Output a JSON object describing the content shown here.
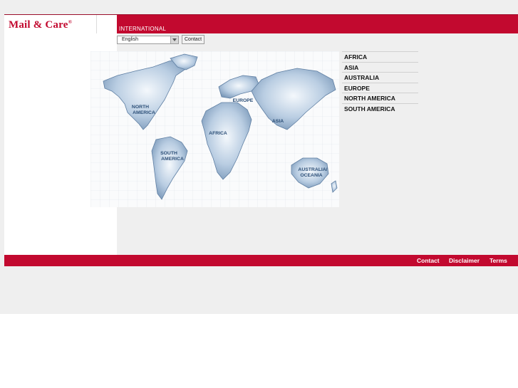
{
  "header": {
    "logo_text": "Mail & Care",
    "logo_mark": "®",
    "section_title": "INTERNATIONAL"
  },
  "toolbar": {
    "language_selected": "English",
    "contact_label": "Contact"
  },
  "map": {
    "labels": {
      "north_america": [
        "NORTH",
        "AMERICA"
      ],
      "south_america": [
        "SOUTH",
        "AMERICA"
      ],
      "europe": [
        "EUROPE"
      ],
      "africa": [
        "AFRICA"
      ],
      "asia": [
        "ASIA"
      ],
      "australia": [
        "AUSTRALIA/",
        "OCEANIA"
      ]
    }
  },
  "regions": [
    {
      "label": "AFRICA"
    },
    {
      "label": "ASIA"
    },
    {
      "label": "AUSTRALIA"
    },
    {
      "label": "EUROPE"
    },
    {
      "label": "NORTH AMERICA"
    },
    {
      "label": "SOUTH AMERICA"
    }
  ],
  "footer": {
    "links": [
      "Contact",
      "Disclaimer",
      "Terms"
    ]
  },
  "colors": {
    "brand_red": "#c2092f",
    "map_land": "#a9c0d9",
    "map_label": "#2b4e77"
  }
}
